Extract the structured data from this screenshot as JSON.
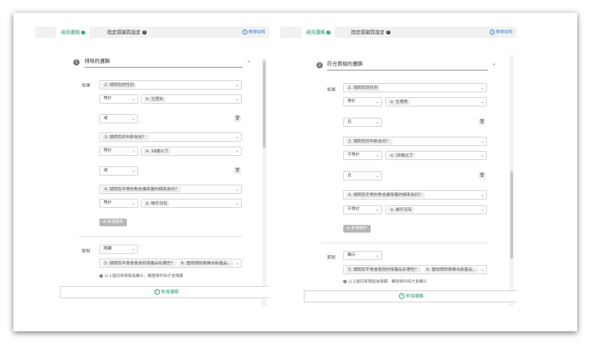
{
  "tabs": {
    "active": "適用邏輯",
    "inactive": "指定感謝頁設定"
  },
  "help": "教學說明",
  "panel1": {
    "step": "1",
    "group_title": "排除的邏輯",
    "if_label": "如果",
    "then_label": "那就",
    "q1": "2. 請問您的性別",
    "op1": "等於",
    "val1": "b. 生理女",
    "conn1": "或",
    "q2": "3. 請問您的年齡為何？",
    "op2": "等於",
    "val2": "a. 18歲以下",
    "conn2": "或",
    "q3": "4. 請問您平常針對皮膚保養的頻率為何？",
    "op3": "等於",
    "val3": "a. 幾乎沒有",
    "add_condition": "新增條件",
    "action": "隱藏",
    "target1": "5. 請問您平常會使用的保養品有哪些？",
    "target2": "6. 當既牌即將推出新產品，",
    "note": "以上題目將預設為顯示，觸發條件時才會隱藏",
    "add_logic": "新增邏輯"
  },
  "panel2": {
    "step": "2",
    "group_title": "符合資格的邏輯",
    "if_label": "如果",
    "then_label": "那就",
    "q1": "2. 請問您的性別",
    "op1": "等於",
    "val1": "a. 生理男",
    "conn1": "且",
    "q2": "3. 請問您的年齡為何？",
    "op2": "不等於",
    "val2": "a. 18歲以下",
    "conn2": "且",
    "q3": "4. 請問您平常針對皮膚保養的頻率為何？",
    "op3": "不等於",
    "val3": "a. 幾乎沒有",
    "add_condition": "新增條件",
    "action": "顯示",
    "target1": "5. 請問您平常會使用的保養品有哪些？",
    "target2": "6. 當既牌即將推出新產品，",
    "note": "以上題目將預設為隱藏，觸發條件時才會顯示",
    "add_logic": "新增邏輯"
  },
  "icons": {
    "chevron": "chevron-down-icon",
    "trash": "trash-icon",
    "help": "help-circle-icon",
    "plus": "plus-circle-icon",
    "info": "info-icon"
  }
}
